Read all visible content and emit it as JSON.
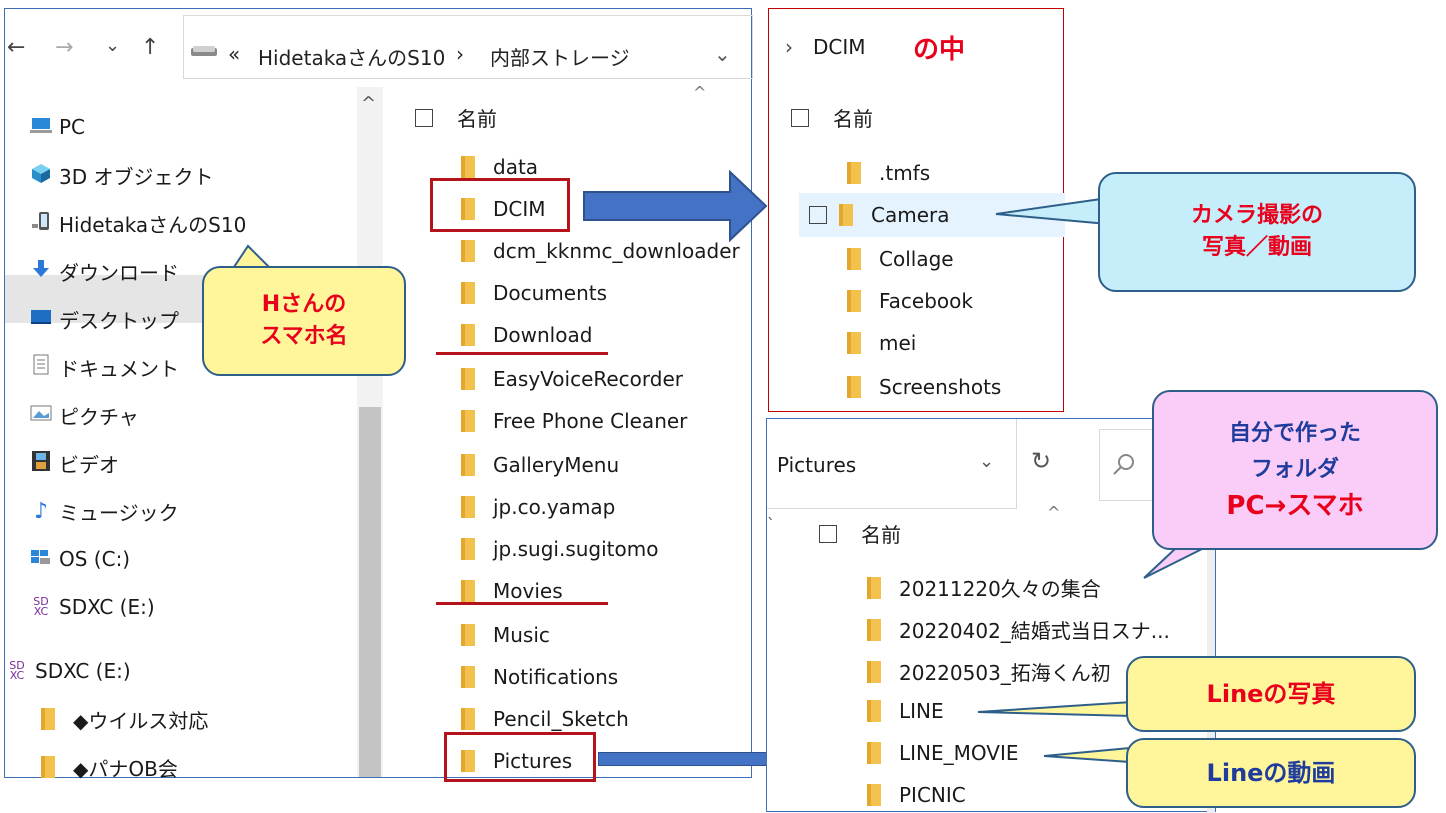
{
  "main_window": {
    "nav_back": "←",
    "nav_forward": "→",
    "nav_recent": "⌄",
    "nav_up": "↑",
    "address": {
      "overflow": "«",
      "device": "HidetakaさんのS10",
      "separator": "›",
      "folder": "内部ストレージ",
      "dropdown": "⌄"
    },
    "sort_arrow": "^",
    "nav_pane": [
      {
        "label": "PC",
        "icon": "pc-icon"
      },
      {
        "label": "3D オブジェクト",
        "icon": "3d-objects-icon"
      },
      {
        "label": "HidetakaさんのS10",
        "icon": "phone-icon",
        "selected": true
      },
      {
        "label": "ダウンロード",
        "icon": "download-icon"
      },
      {
        "label": "デスクトップ",
        "icon": "desktop-icon"
      },
      {
        "label": "ドキュメント",
        "icon": "document-icon"
      },
      {
        "label": "ピクチャ",
        "icon": "pictures-icon"
      },
      {
        "label": "ビデオ",
        "icon": "video-icon"
      },
      {
        "label": "ミュージック",
        "icon": "music-icon"
      },
      {
        "label": "OS (C:)",
        "icon": "drive-icon"
      },
      {
        "label": "SDXC (E:)",
        "icon": "sd-card-icon"
      },
      {
        "label": "SDXC (E:)",
        "icon": "sd-card-icon"
      },
      {
        "label": "◆ウイルス対応",
        "icon": "folder-icon"
      },
      {
        "label": "◆パナOB会",
        "icon": "folder-icon"
      }
    ],
    "column_header": "名前",
    "files": [
      "data",
      "DCIM",
      "dcm_kknmc_downloader",
      "Documents",
      "Download",
      "EasyVoiceRecorder",
      "Free Phone Cleaner",
      "GalleryMenu",
      "jp.co.yamap",
      "jp.sugi.sugitomo",
      "Movies",
      "Music",
      "Notifications",
      "Pencil_Sketch",
      "Pictures"
    ]
  },
  "dcim_window": {
    "chevron": "›",
    "path": "DCIM",
    "caption": "の中",
    "column_header": "名前",
    "files": [
      ".tmfs",
      "Camera",
      "Collage",
      "Facebook",
      "mei",
      "Screenshots"
    ]
  },
  "pictures_window": {
    "path": "Pictures",
    "dropdown": "⌄",
    "refresh": "↻",
    "sort_arrow": "^",
    "column_header": "名前",
    "files": [
      "20211220久々の集合",
      "20220402_結婚式当日スナ...",
      "20220503_拓海くん初",
      "LINE",
      "LINE_MOVIE",
      "PICNIC"
    ]
  },
  "callouts": {
    "phone_name": [
      "Hさんの",
      "スマホ名"
    ],
    "camera": [
      "カメラ撮影の",
      "写真／動画"
    ],
    "own_folder": [
      "自分で作った",
      "フォルダ",
      "PC→スマホ"
    ],
    "line_photo": "Lineの写真",
    "line_movie": "Lineの動画"
  },
  "colors": {
    "accent_red": "#b5121b",
    "arrow_blue": "#4472c4",
    "callout_yellow": "#fff59a",
    "callout_cyan": "#c6eefa",
    "callout_pink": "#f9cdf7",
    "callout_text_red": "#e8001c",
    "callout_text_blue": "#1f3c9c",
    "selection": "#e5f3ff"
  }
}
